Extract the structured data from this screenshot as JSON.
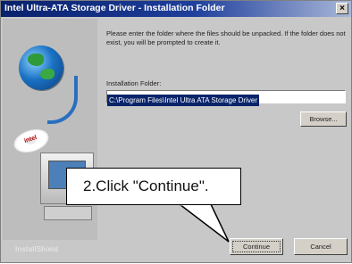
{
  "window": {
    "title": "Intel Ultra-ATA Storage Driver - Installation Folder",
    "close_glyph": "×"
  },
  "art": {
    "cd_label": "intel",
    "brand_text": "InstallShield"
  },
  "content": {
    "instructions": "Please enter the folder where the files should be unpacked. If the folder does not exist, you will be prompted to create it.",
    "folder_label": "Installation Folder:",
    "folder_value": "C:\\Program Files\\Intel Ultra ATA Storage Driver"
  },
  "buttons": {
    "browse": "Browse...",
    "continue": "Continue",
    "cancel": "Cancel"
  },
  "callout": {
    "text": "2.Click \"Continue\"."
  }
}
